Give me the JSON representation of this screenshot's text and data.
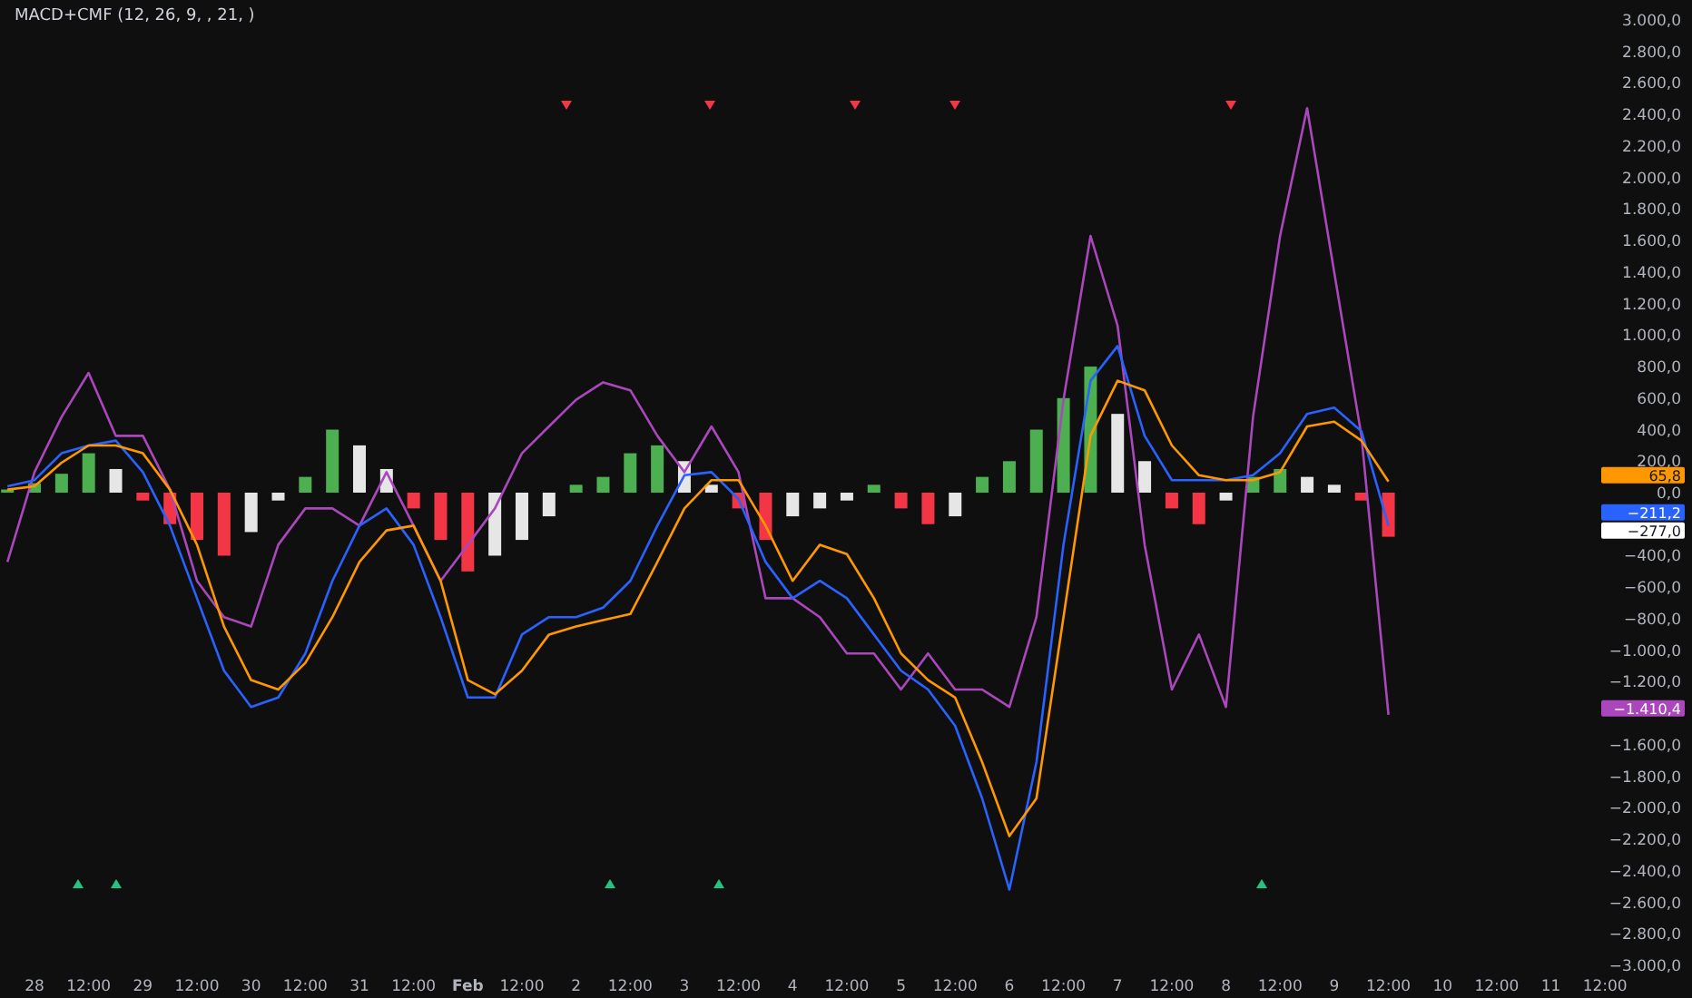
{
  "indicator": {
    "title": "MACD+CMF (12, 26, 9, , 21, )"
  },
  "chart": {
    "chart_data": {
      "type": "line",
      "ylim": [
        -3000,
        3000
      ],
      "categories": [
        null,
        "28",
        null,
        "12:00",
        null,
        "29",
        null,
        "12:00",
        null,
        "30",
        null,
        "12:00",
        null,
        "31",
        null,
        "12:00",
        null,
        "Feb",
        null,
        "12:00",
        null,
        "2",
        null,
        "12:00",
        null,
        "3",
        null,
        "12:00",
        null,
        "4",
        null,
        "12:00",
        null,
        "5",
        null,
        "12:00",
        null,
        "6",
        null,
        "12:00",
        null,
        "7",
        null,
        "12:00",
        null,
        "8",
        null,
        "12:00",
        null,
        "9",
        null,
        "12:00",
        null,
        "10",
        null,
        "12:00",
        null,
        "11",
        null,
        "12:00"
      ],
      "yticks": [
        {
          "value": 3000,
          "label": "3.000,0"
        },
        {
          "value": 2800,
          "label": "2.800,0"
        },
        {
          "value": 2600,
          "label": "2.600,0"
        },
        {
          "value": 2400,
          "label": "2.400,0"
        },
        {
          "value": 2200,
          "label": "2.200,0"
        },
        {
          "value": 2000,
          "label": "2.000,0"
        },
        {
          "value": 1800,
          "label": "1.800,0"
        },
        {
          "value": 1600,
          "label": "1.600,0"
        },
        {
          "value": 1400,
          "label": "1.400,0"
        },
        {
          "value": 1200,
          "label": "1.200,0"
        },
        {
          "value": 1000,
          "label": "1.000,0"
        },
        {
          "value": 800,
          "label": "800,0"
        },
        {
          "value": 600,
          "label": "600,0"
        },
        {
          "value": 400,
          "label": "400,0"
        },
        {
          "value": 200,
          "label": "200,0"
        },
        {
          "value": 0,
          "label": "0,0"
        },
        {
          "value": -400,
          "label": "−400,0"
        },
        {
          "value": -600,
          "label": "−600,0"
        },
        {
          "value": -800,
          "label": "−800,0"
        },
        {
          "value": -1000,
          "label": "−1.000,0"
        },
        {
          "value": -1200,
          "label": "−1.200,0"
        },
        {
          "value": -1600,
          "label": "−1.600,0"
        },
        {
          "value": -1800,
          "label": "−1.800,0"
        },
        {
          "value": -2000,
          "label": "−2.000,0"
        },
        {
          "value": -2200,
          "label": "−2.200,0"
        },
        {
          "value": -2400,
          "label": "−2.400,0"
        },
        {
          "value": -2600,
          "label": "−2.600,0"
        },
        {
          "value": -2800,
          "label": "−2.800,0"
        },
        {
          "value": -3000,
          "label": "−3.000,0"
        }
      ],
      "series": [
        {
          "color": "#ab47bc",
          "values": [
            -440,
            130,
            480,
            760,
            360,
            360,
            20,
            -560,
            -790,
            -850,
            -330,
            -100,
            -100,
            -210,
            130,
            -210,
            -560,
            -330,
            -100,
            250,
            420,
            590,
            700,
            650,
            360,
            130,
            420,
            130,
            -670,
            -670,
            -790,
            -1020,
            -1020,
            -1250,
            -1020,
            -1250,
            -1250,
            -1360,
            -790,
            590,
            1630,
            1060,
            -330,
            -1250,
            -900,
            -1360,
            480,
            1630,
            2440,
            1400,
            360,
            -1410,
            null,
            null,
            null,
            null,
            null,
            null,
            null,
            null
          ]
        },
        {
          "color": "#2962ff",
          "values": [
            40,
            80,
            250,
            300,
            330,
            130,
            -210,
            -670,
            -1130,
            -1360,
            -1300,
            -1020,
            -560,
            -210,
            -100,
            -330,
            -790,
            -1300,
            -1300,
            -900,
            -790,
            -790,
            -730,
            -560,
            -210,
            110,
            130,
            -40,
            -440,
            -670,
            -560,
            -670,
            -900,
            -1130,
            -1250,
            -1480,
            -1940,
            -2520,
            -1710,
            -330,
            710,
            930,
            360,
            80,
            80,
            80,
            110,
            250,
            500,
            540,
            390,
            -210,
            null,
            null,
            null,
            null,
            null,
            null,
            null,
            null
          ]
        },
        {
          "color": "#ff9800",
          "values": [
            20,
            40,
            190,
            300,
            300,
            250,
            20,
            -330,
            -850,
            -1190,
            -1250,
            -1080,
            -790,
            -440,
            -240,
            -210,
            -560,
            -1190,
            -1280,
            -1130,
            -900,
            -850,
            -810,
            -770,
            -440,
            -100,
            80,
            80,
            -210,
            -560,
            -330,
            -390,
            -670,
            -1020,
            -1190,
            -1300,
            -1710,
            -2180,
            -1940,
            -790,
            360,
            710,
            650,
            300,
            110,
            80,
            80,
            130,
            420,
            450,
            330,
            70,
            null,
            null,
            null,
            null,
            null,
            null,
            null,
            null
          ]
        }
      ]
    },
    "value_badges": [
      {
        "text": "65,8",
        "color": "#ff9800"
      },
      {
        "text": "−211,2",
        "color": "#2962ff"
      },
      {
        "text": "−277,0",
        "color": "#ffffff"
      },
      {
        "text": "−1.410,4",
        "color": "#ab47bc"
      }
    ]
  }
}
